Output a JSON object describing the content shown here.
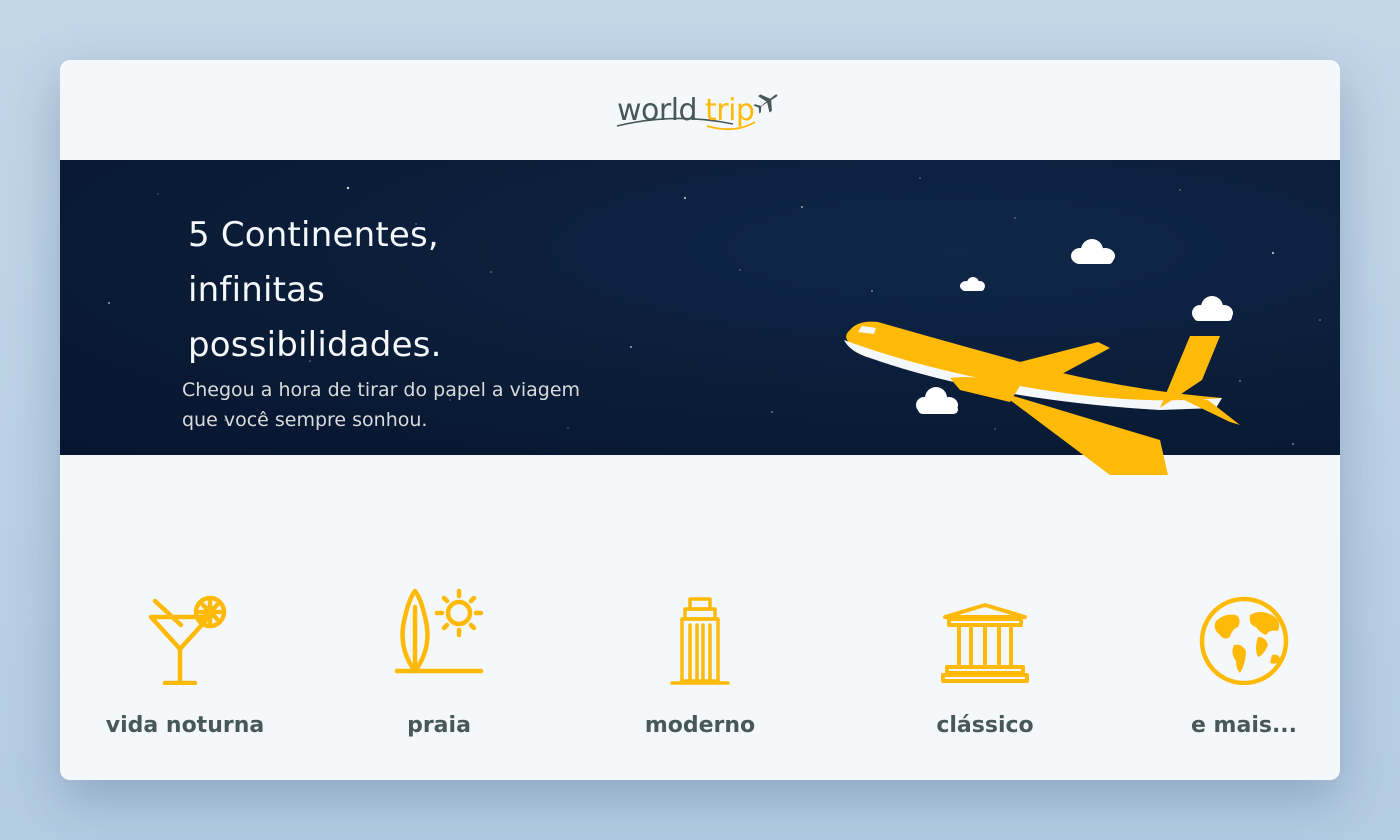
{
  "logo": {
    "word_1": "world",
    "word_2": "trip"
  },
  "banner": {
    "title_line_1": "5 Continentes,",
    "title_line_2": "infinitas",
    "title_line_3": "possibilidades.",
    "subtitle_line_1": "Chegou a hora de tirar do papel a viagem",
    "subtitle_line_2": "que você sempre sonhou."
  },
  "travel_types": [
    {
      "label": "vida noturna",
      "icon": "cocktail-icon"
    },
    {
      "label": "praia",
      "icon": "surfboard-sun-icon"
    },
    {
      "label": "moderno",
      "icon": "skyscraper-icon"
    },
    {
      "label": "clássico",
      "icon": "classic-building-icon"
    },
    {
      "label": "e mais...",
      "icon": "globe-icon"
    }
  ],
  "colors": {
    "accent": "#ffba08",
    "text_dark": "#47585b",
    "banner_bg": "#0a1c37",
    "light_bg": "#f5f8fa"
  }
}
